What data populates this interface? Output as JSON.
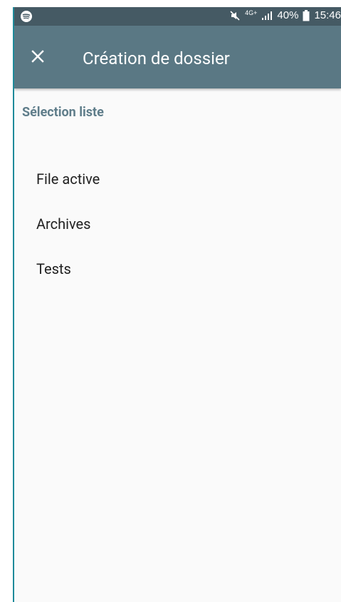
{
  "status_bar": {
    "network": "4G+",
    "battery": "40%",
    "time": "15:46"
  },
  "toolbar": {
    "title": "Création de dossier",
    "close_icon": "close-icon"
  },
  "section": {
    "header": "Sélection liste"
  },
  "list": {
    "items": [
      {
        "label": "File active"
      },
      {
        "label": "Archives"
      },
      {
        "label": "Tests"
      }
    ]
  },
  "colors": {
    "status_bar": "#455a64",
    "toolbar": "#5a7884",
    "section_header": "#5f7d8a",
    "background": "#fafafa",
    "accent_border": "#1e8a9a"
  }
}
